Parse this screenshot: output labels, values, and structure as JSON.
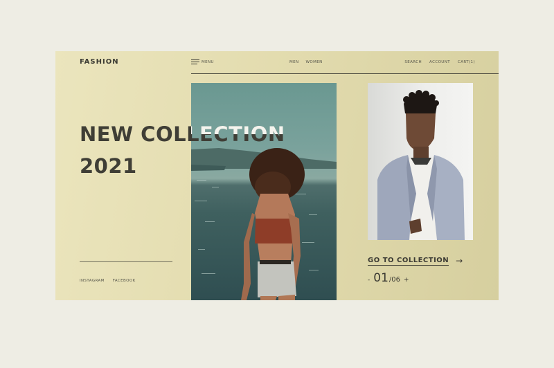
{
  "brand": "FASHION",
  "nav": {
    "menu_label": "MENU",
    "center": [
      "MEN",
      "WOMEN"
    ],
    "right": [
      "SEARCH",
      "ACCOUNT",
      "CART(1)"
    ]
  },
  "hero": {
    "line1": "NEW COLLECTION",
    "line2": "2021"
  },
  "social": [
    "INSTAGRAM",
    "FACEBOOK"
  ],
  "cta": {
    "label": "GO TO COLLECTION",
    "arrow": "→"
  },
  "pager": {
    "prev": "-",
    "current": "01",
    "total": "/06",
    "next": "+"
  },
  "colors": {
    "page_bg": "#eeede4",
    "frame_bg": "#e3dcaf",
    "text": "#3f3e36",
    "hero_overlay_text": "#f4f4ee"
  }
}
